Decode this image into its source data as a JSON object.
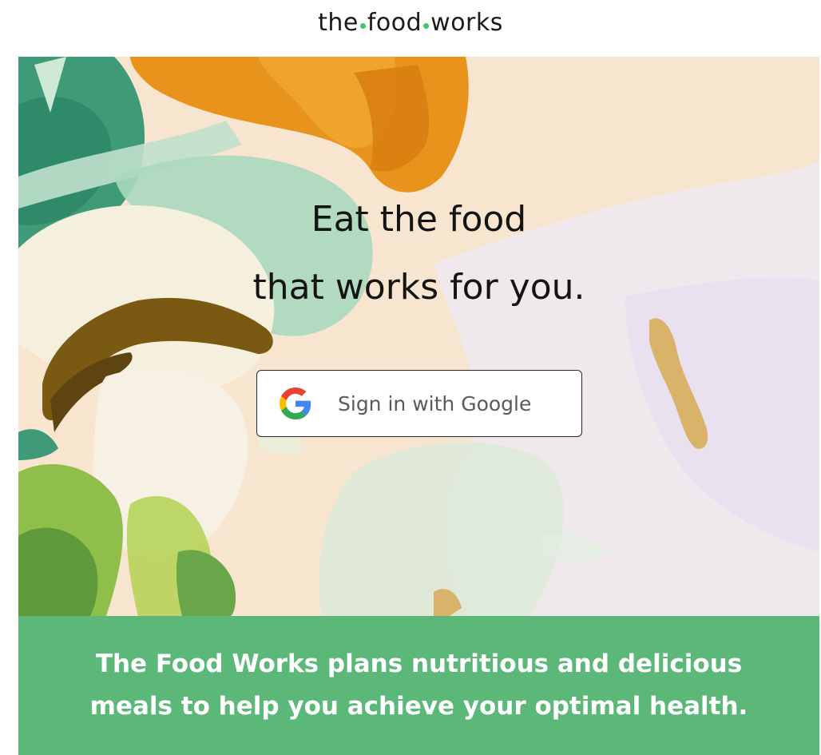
{
  "logo": {
    "part1": "the",
    "part2": "food",
    "part3": "works",
    "dot_color": "#3cc76a"
  },
  "hero": {
    "headline_line1": "Eat the food",
    "headline_line2": "that works for you."
  },
  "signin": {
    "label": "Sign in with Google",
    "icon": "google-g-icon"
  },
  "banner": {
    "line1": "The Food Works plans nutritious and delicious",
    "line2": "meals to help you achieve your optimal health.",
    "color": "#5cb879"
  },
  "colors": {
    "banner": "#5cb879",
    "logo_dot": "#3cc76a",
    "hero_peach": "#f6e4cf",
    "hero_teal": "#3f9a78",
    "hero_orange": "#e8931c",
    "hero_olive": "#7a5a12"
  }
}
